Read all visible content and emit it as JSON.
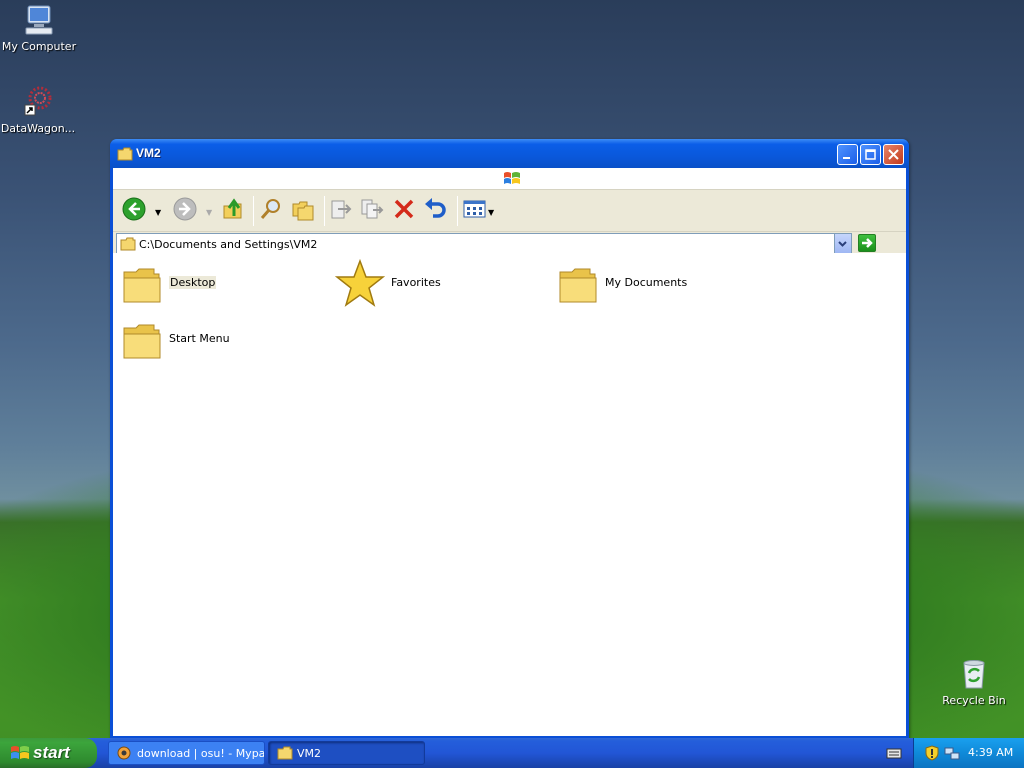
{
  "desktop": {
    "icons": [
      {
        "label": "My Computer"
      },
      {
        "label": "DataWagon..."
      },
      {
        "label": "Recycle Bin"
      }
    ]
  },
  "window": {
    "title": "VM2",
    "address": "C:\\Documents and Settings\\VM2",
    "items": [
      {
        "label": "Desktop",
        "icon": "folder-icon",
        "selected": true
      },
      {
        "label": "Favorites",
        "icon": "star-icon"
      },
      {
        "label": "My Documents",
        "icon": "folder-icon"
      },
      {
        "label": "Start Menu",
        "icon": "folder-icon"
      }
    ]
  },
  "taskbar": {
    "start_label": "start",
    "tasks": [
      {
        "label": "download | osu! - Mypal",
        "active": false
      },
      {
        "label": "VM2",
        "active": true
      }
    ],
    "clock": "4:39 AM"
  },
  "colors": {
    "title_blue": "#0a58db",
    "taskbar_blue": "#245edb",
    "start_green": "#3ca53c",
    "tray_blue": "#0f8ad9",
    "selection_bg": "#ece9d8"
  }
}
